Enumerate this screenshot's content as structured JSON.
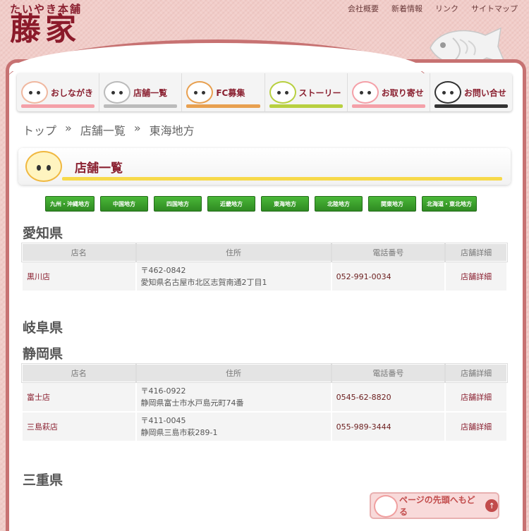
{
  "header": {
    "logo_sub": "たいやき本舗",
    "logo_main": "藤家",
    "top_links": [
      "会社概要",
      "新着情報",
      "リンク",
      "サイトマップ"
    ]
  },
  "nav": {
    "items": [
      {
        "label": "おしながき",
        "color": "#f4a0a8"
      },
      {
        "label": "店舗一覧",
        "color": "#bbbbbb"
      },
      {
        "label": "FC募集",
        "color": "#e8a050"
      },
      {
        "label": "ストーリー",
        "color": "#b8d040"
      },
      {
        "label": "お取り寄せ",
        "color": "#f4a0a8"
      },
      {
        "label": "お問い合せ",
        "color": "#333333"
      }
    ]
  },
  "breadcrumb": {
    "items": [
      "トップ",
      "»",
      "店舗一覧",
      "»",
      "東海地方"
    ]
  },
  "section": {
    "title": "店舗一覧"
  },
  "regions": [
    "九州・沖縄地方",
    "中国地方",
    "四国地方",
    "近畿地方",
    "東海地方",
    "北陸地方",
    "関東地方",
    "北海道・東北地方"
  ],
  "table_headers": {
    "name": "店名",
    "address": "住所",
    "phone": "電話番号",
    "detail": "店舗詳細"
  },
  "prefectures": {
    "aichi": {
      "name": "愛知県",
      "stores": [
        {
          "name": "黒川店",
          "zip": "〒462-0842",
          "address": "愛知県名古屋市北区志賀南通2丁目1",
          "phone": "052-991-0034",
          "detail": "店舗詳細"
        }
      ]
    },
    "gifu": {
      "name": "岐阜県"
    },
    "shizuoka": {
      "name": "静岡県",
      "stores": [
        {
          "name": "富士店",
          "zip": "〒416-0922",
          "address": "静岡県富士市水戸島元町74番",
          "phone": "0545-62-8820",
          "detail": "店舗詳細"
        },
        {
          "name": "三島萩店",
          "zip": "〒411-0045",
          "address": "静岡県三島市萩289-1",
          "phone": "055-989-3444",
          "detail": "店舗詳細"
        }
      ]
    },
    "mie": {
      "name": "三重県"
    }
  },
  "page_top": {
    "label": "ページの先頭へもどる",
    "arrow": "↑"
  }
}
